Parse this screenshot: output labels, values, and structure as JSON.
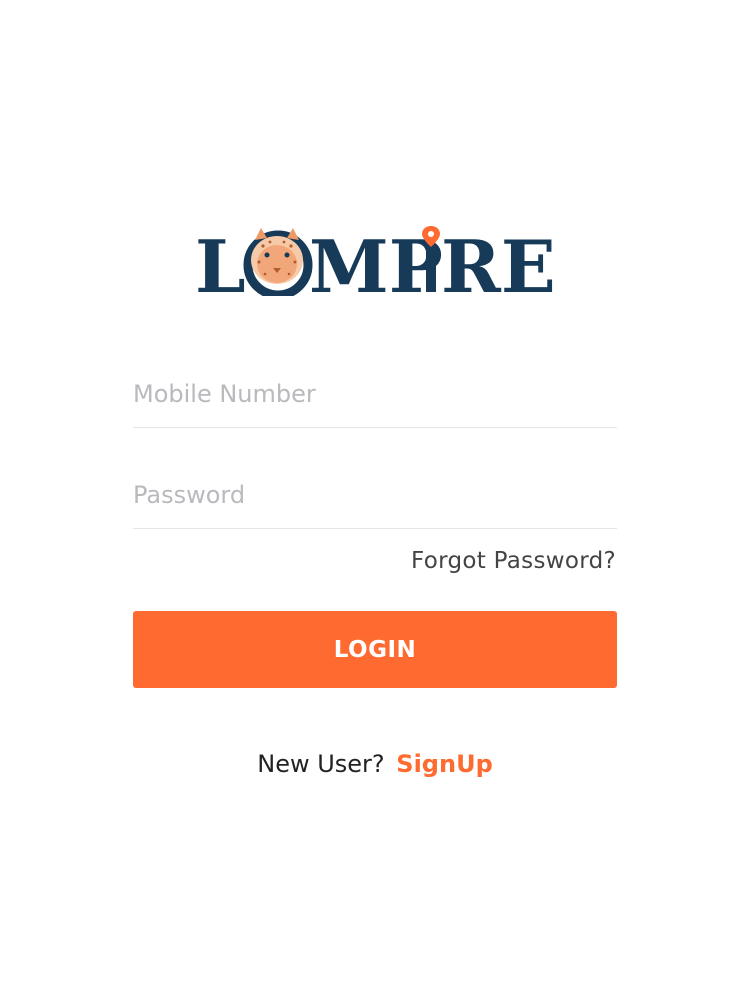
{
  "brand": {
    "logo_text": "LOMPIRE",
    "navy": "#163a58",
    "accent": "#ff6a30"
  },
  "form": {
    "mobile": {
      "placeholder": "Mobile Number",
      "value": ""
    },
    "password": {
      "placeholder": "Password",
      "value": ""
    },
    "forgot_label": "Forgot Password?",
    "login_label": "LOGIN"
  },
  "signup": {
    "prompt": "New User?",
    "link_label": "SignUp"
  },
  "icons": {
    "logo_mark": "leopard-head-icon",
    "location_pin": "location-pin-icon"
  }
}
